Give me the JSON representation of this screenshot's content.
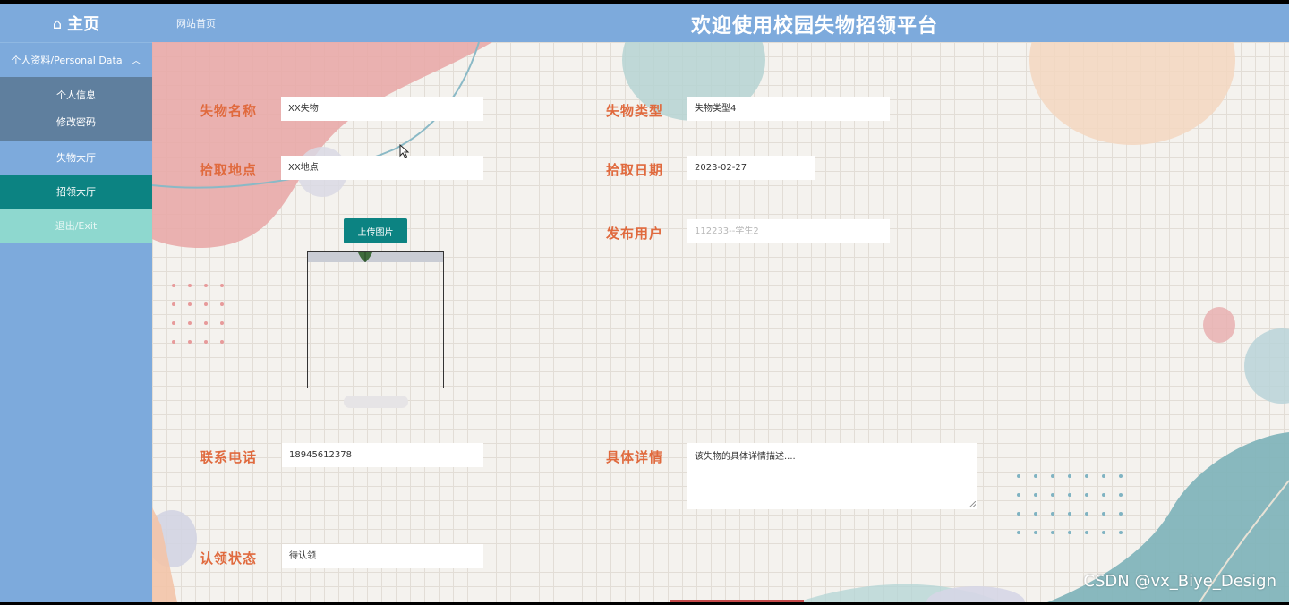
{
  "header": {
    "brand_label": "主页",
    "brand_icon": "home-icon",
    "site_link": "网站首页",
    "title": "欢迎使用校园失物招领平台"
  },
  "sidebar": {
    "group_title": "个人资料/Personal Data",
    "sub_items": [
      "个人信息",
      "修改密码"
    ],
    "items": [
      {
        "label": "失物大厅",
        "active": false
      },
      {
        "label": "招领大厅",
        "active": true
      },
      {
        "label": "退出/Exit",
        "active": false
      }
    ]
  },
  "form": {
    "name_label": "失物名称",
    "name_value": "XX失物",
    "type_label": "失物类型",
    "type_value": "失物类型4",
    "place_label": "拾取地点",
    "place_value": "XX地点",
    "date_label": "拾取日期",
    "date_value": "2023-02-27",
    "upload_label": "上传图片",
    "user_label": "发布用户",
    "user_value": "112233--学生2",
    "phone_label": "联系电话",
    "phone_value": "18945612378",
    "detail_label": "具体详情",
    "detail_value": "该失物的具体详情描述....",
    "status_label": "认领状态",
    "status_value": "待认领"
  },
  "watermark": "CSDN @vx_Biye_Design",
  "colors": {
    "accent": "#0c8382",
    "topbar": "#7daadc",
    "label": "#e06a3e",
    "submenu": "#5f7f9e",
    "exit": "#8ed8cf"
  }
}
